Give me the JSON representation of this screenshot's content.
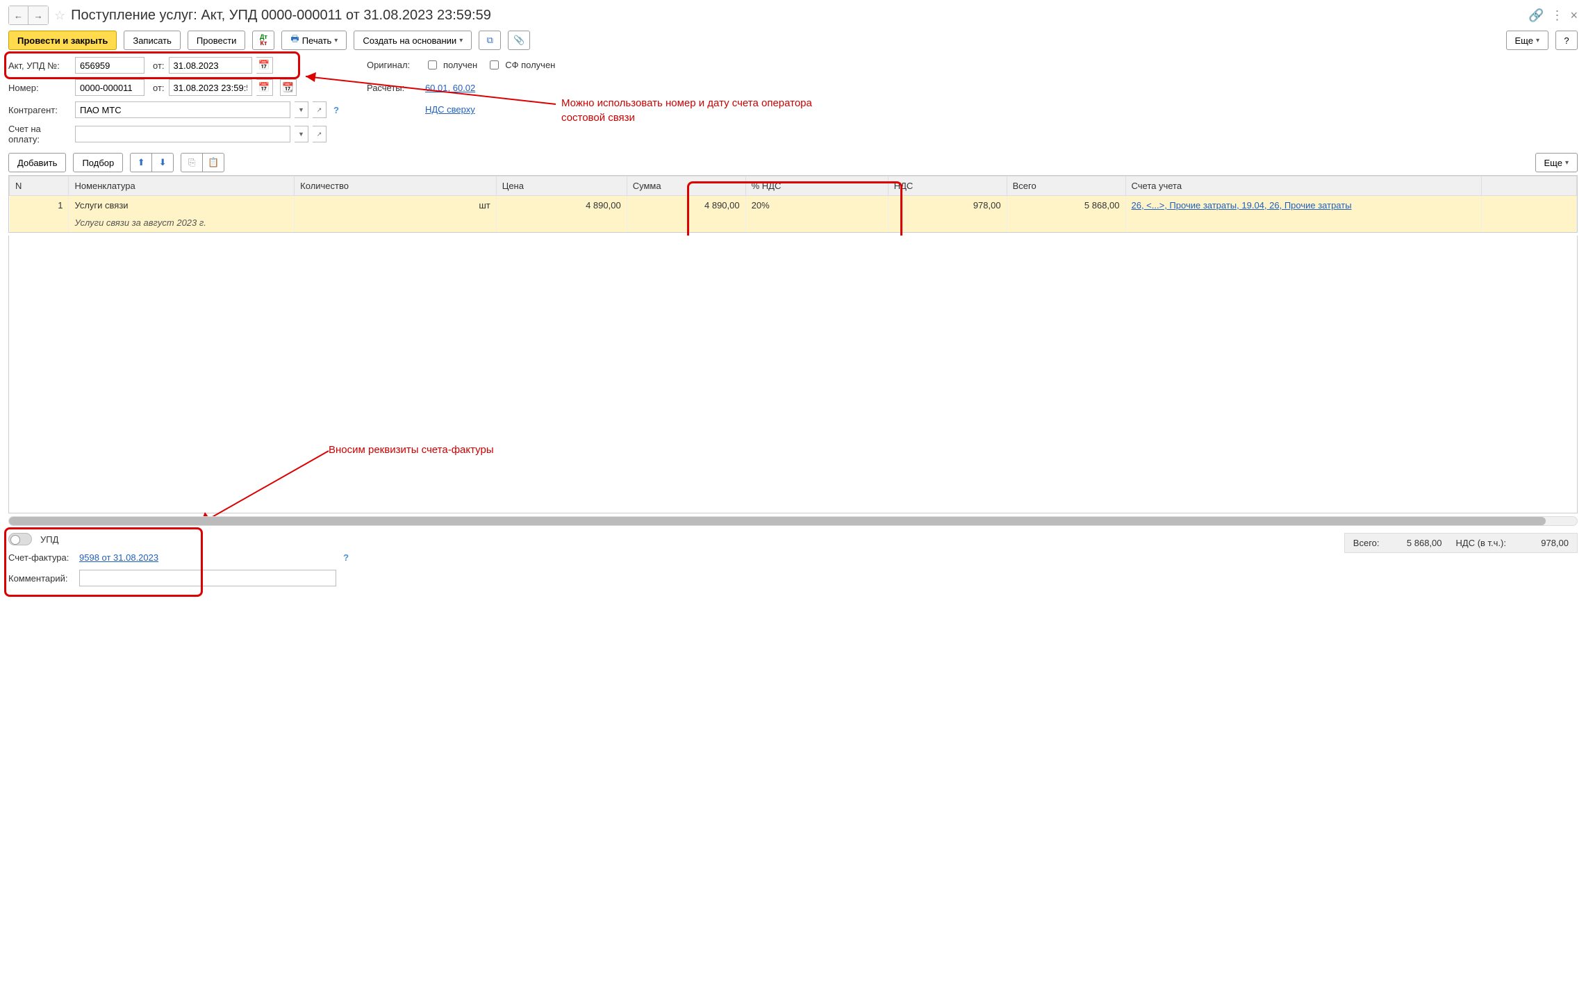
{
  "title": "Поступление услуг: Акт, УПД 0000-000011 от 31.08.2023 23:59:59",
  "toolbar": {
    "post_close": "Провести и закрыть",
    "save": "Записать",
    "post": "Провести",
    "print": "Печать",
    "create_based": "Создать на основании",
    "more": "Еще",
    "help": "?"
  },
  "form": {
    "act_label": "Акт, УПД №:",
    "act_value": "656959",
    "from": "от:",
    "act_date": "31.08.2023",
    "number_label": "Номер:",
    "number_value": "0000-000011",
    "number_date": "31.08.2023 23:59:59",
    "counterparty_label": "Контрагент:",
    "counterparty_value": "ПАО МТС",
    "invoice_label": "Счет на оплату:",
    "invoice_value": "",
    "original_label": "Оригинал:",
    "received": "получен",
    "sf_received": "СФ получен",
    "settlements_label": "Расчеты:",
    "settlements_value": "60.01, 60.02",
    "vat_mode": "НДС сверху"
  },
  "annotations": {
    "top": "Можно использовать номер и дату счета оператора состовой связи",
    "bottom": "Вносим реквизиты счета-фактуры"
  },
  "table_toolbar": {
    "add": "Добавить",
    "select": "Подбор",
    "more": "Еще"
  },
  "table": {
    "headers": {
      "n": "N",
      "nomenclature": "Номенклатура",
      "quantity": "Количество",
      "price": "Цена",
      "sum": "Сумма",
      "vat_pct": "% НДС",
      "vat": "НДС",
      "total": "Всего",
      "accounts": "Счета учета"
    },
    "row": {
      "n": "1",
      "nomenclature": "Услуги связи",
      "nomenclature_sub": "Услуги связи за август 2023 г.",
      "quantity_unit": "шт",
      "price": "4 890,00",
      "sum": "4 890,00",
      "vat_pct": "20%",
      "vat": "978,00",
      "total": "5 868,00",
      "accounts": "26, <...>, Прочие затраты, 19.04, 26, Прочие затраты"
    }
  },
  "footer": {
    "upd_label": "УПД",
    "sf_label": "Счет-фактура:",
    "sf_value": "9598 от 31.08.2023",
    "comment_label": "Комментарий:",
    "comment_value": "",
    "total_label": "Всего:",
    "total_value": "5 868,00",
    "vat_incl_label": "НДС (в т.ч.):",
    "vat_incl_value": "978,00"
  }
}
